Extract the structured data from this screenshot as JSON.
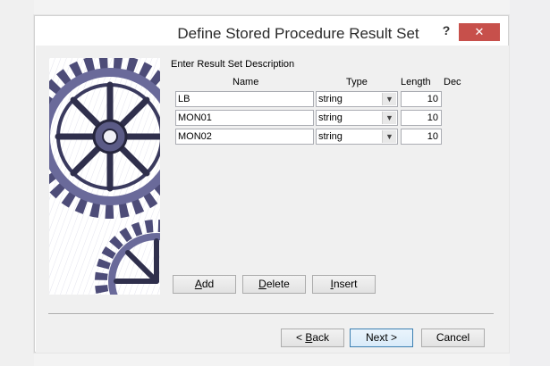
{
  "window": {
    "title": "Define Stored Procedure Result Set",
    "help_label": "?",
    "close_label": "✕"
  },
  "form": {
    "section_label": "Enter Result Set Description",
    "columns": {
      "name": "Name",
      "type": "Type",
      "length": "Length",
      "dec": "Dec"
    },
    "rows": [
      {
        "name": "LB",
        "type": "string",
        "length": "10"
      },
      {
        "name": "MON01",
        "type": "string",
        "length": "10"
      },
      {
        "name": "MON02",
        "type": "string",
        "length": "10"
      }
    ]
  },
  "actions": {
    "add": {
      "pre": "",
      "accel": "A",
      "post": "dd"
    },
    "delete": {
      "pre": "",
      "accel": "D",
      "post": "elete"
    },
    "insert": {
      "pre": "",
      "accel": "I",
      "post": "nsert"
    }
  },
  "nav": {
    "back": {
      "pre": "< ",
      "accel": "B",
      "post": "ack"
    },
    "next": "Next >",
    "cancel": "Cancel"
  },
  "icons": {
    "decoration": "gears-illustration",
    "dropdown": "chevron-down-icon",
    "close": "close-icon",
    "help": "help-icon"
  }
}
